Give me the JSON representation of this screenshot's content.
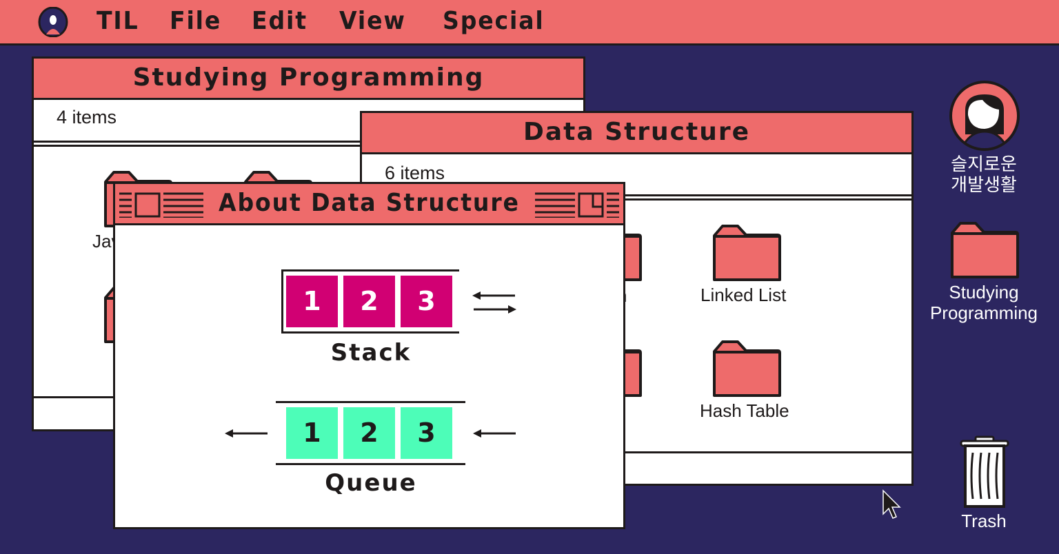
{
  "colors": {
    "desktop": "#2c2660",
    "accent": "#ee6b6b",
    "stack_cell": "#d10073",
    "queue_cell": "#4dfdb8",
    "outline": "#1e1a1a"
  },
  "menubar": {
    "logo_icon": "user-avatar-icon",
    "items": [
      {
        "label": "TIL"
      },
      {
        "label": "File"
      },
      {
        "label": "Edit"
      },
      {
        "label": "View"
      },
      {
        "label": "Special"
      }
    ]
  },
  "window_programming": {
    "title": "Studying Programming",
    "count": "4 items",
    "visible_labels": [
      "Jav"
    ]
  },
  "window_datastructure": {
    "title": "Data Structure",
    "count": "6 items",
    "partial_label": "n",
    "folders": [
      {
        "label": "Linked List"
      },
      {
        "label": "Hash Table"
      }
    ]
  },
  "window_about": {
    "title": "About Data Structure",
    "stack": {
      "label": "Stack",
      "cells": [
        "1",
        "2",
        "3"
      ],
      "arrows": [
        "push-pop-arrows-icon"
      ]
    },
    "queue": {
      "label": "Queue",
      "cells": [
        "1",
        "2",
        "3"
      ],
      "arrows": [
        "dequeue-arrow-icon",
        "enqueue-arrow-icon"
      ]
    }
  },
  "desktop": {
    "profile": {
      "line1": "슬지로운",
      "line2": "개발생활"
    },
    "folder": {
      "line1": "Studying",
      "line2": "Programming"
    },
    "trash": {
      "label": "Trash"
    }
  }
}
